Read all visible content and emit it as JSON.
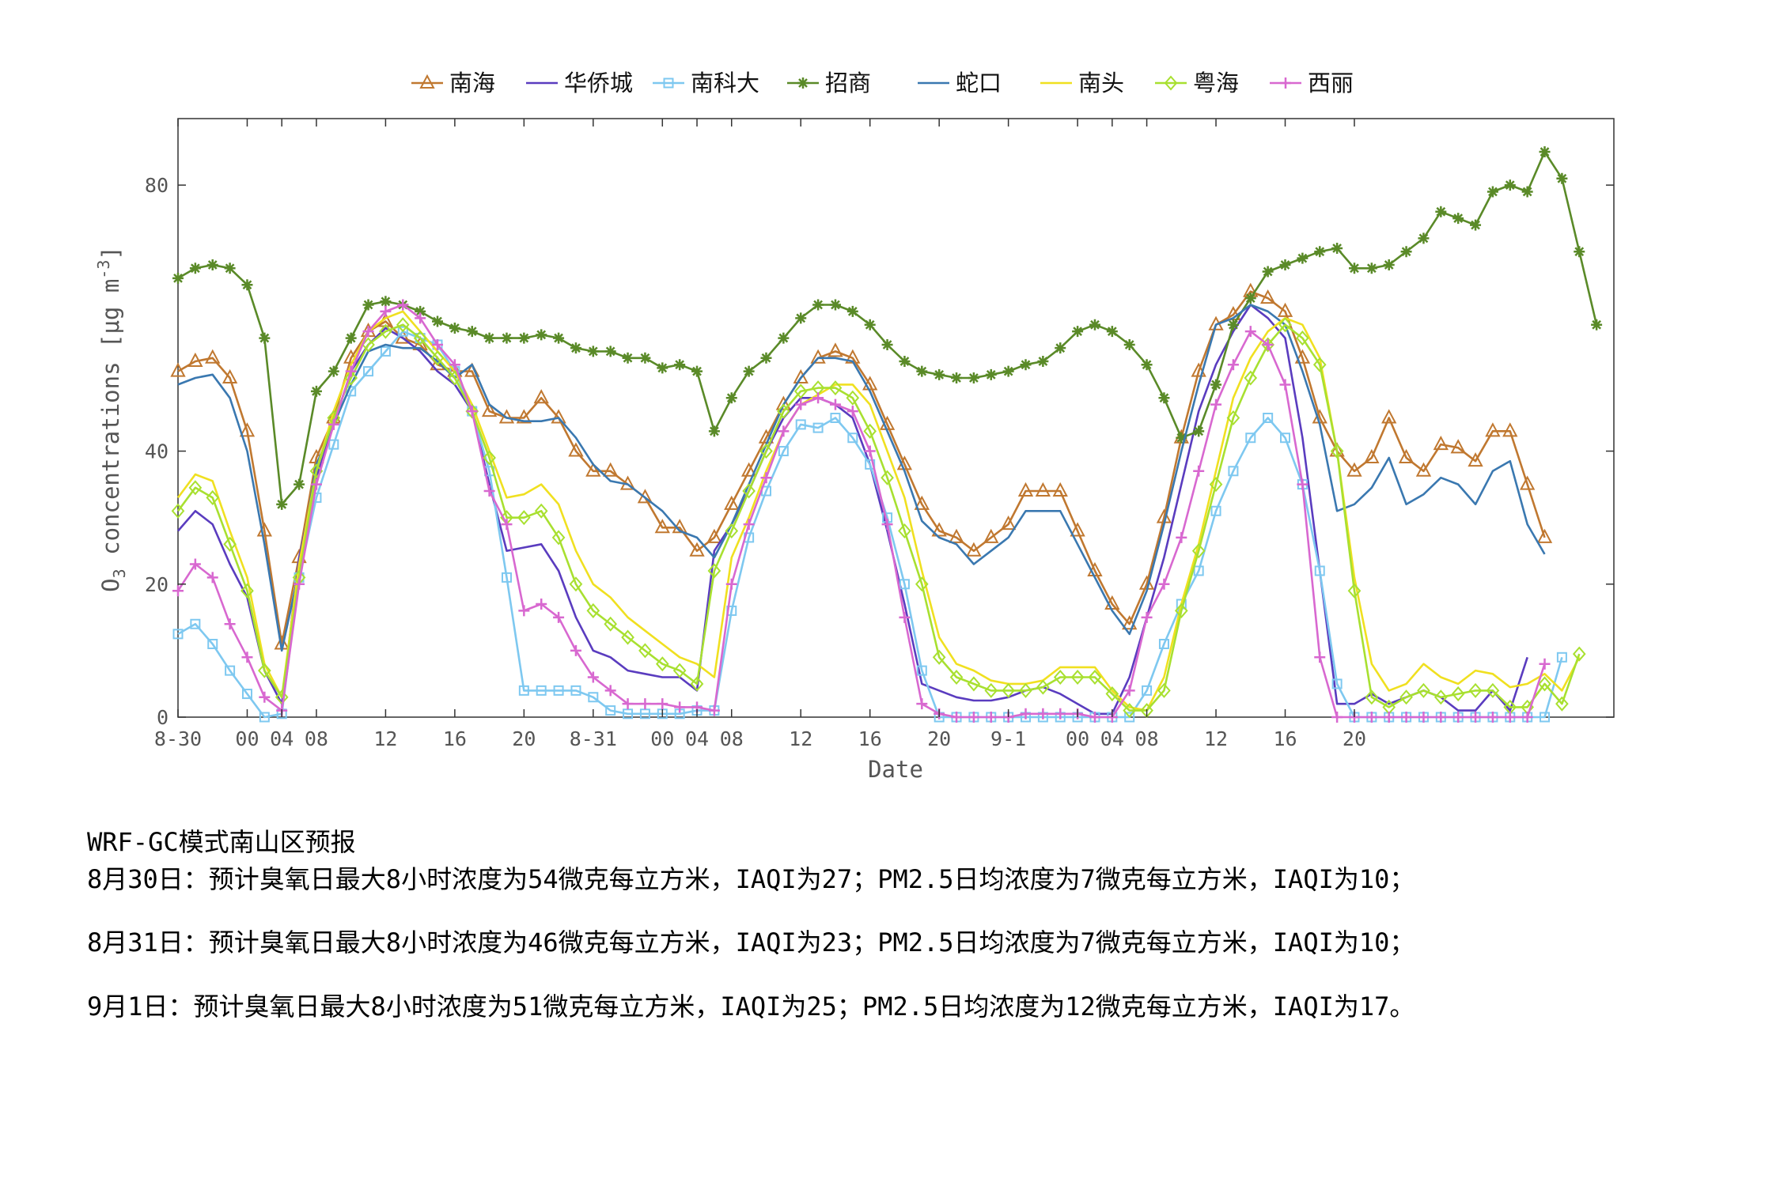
{
  "chart_data": {
    "type": "line",
    "title": "",
    "xlabel": "Date",
    "ylabel_main": "O",
    "ylabel_sub": "3",
    "ylabel_rest": " concentrations [μg m",
    "ylabel_sup": "-3",
    "ylabel_end": "]",
    "ylim": [
      0,
      90
    ],
    "yticks": [
      0,
      20,
      40,
      80
    ],
    "xlim": [
      0,
      83
    ],
    "xticks": [
      {
        "x": 0,
        "label": "8-30"
      },
      {
        "x": 4,
        "label": "00"
      },
      {
        "x": 6,
        "label": "04"
      },
      {
        "x": 8,
        "label": "08"
      },
      {
        "x": 12,
        "label": "12"
      },
      {
        "x": 16,
        "label": "16"
      },
      {
        "x": 20,
        "label": "20"
      },
      {
        "x": 24,
        "label": "8-31"
      },
      {
        "x": 28,
        "label": "00"
      },
      {
        "x": 30,
        "label": "04"
      },
      {
        "x": 32,
        "label": "08"
      },
      {
        "x": 36,
        "label": "12"
      },
      {
        "x": 40,
        "label": "16"
      },
      {
        "x": 44,
        "label": "20"
      },
      {
        "x": 48,
        "label": "9-1"
      },
      {
        "x": 52,
        "label": "00"
      },
      {
        "x": 54,
        "label": "04"
      },
      {
        "x": 56,
        "label": "08"
      },
      {
        "x": 60,
        "label": "12"
      },
      {
        "x": 64,
        "label": "16"
      },
      {
        "x": 68,
        "label": "20"
      }
    ],
    "legend_position": "top",
    "grid": false,
    "series": [
      {
        "name": "南海",
        "color": "#c07830",
        "marker": "triangle",
        "values": [
          52,
          53.5,
          54,
          51,
          43,
          28,
          11,
          24,
          39,
          45,
          54,
          58,
          59.5,
          57,
          56,
          53,
          52,
          52,
          46,
          45,
          45,
          48,
          45,
          40,
          37,
          37,
          35,
          33,
          28.5,
          28.5,
          25,
          27,
          32,
          37,
          42,
          47,
          51,
          54,
          55,
          54,
          50,
          44,
          38,
          32,
          28,
          27,
          25,
          27,
          29,
          34,
          34,
          34,
          28,
          22,
          17,
          14,
          20,
          30,
          42,
          52,
          59,
          60.5,
          64,
          63,
          61,
          54,
          45,
          40,
          37,
          39,
          45,
          39,
          37,
          41,
          40.5,
          38.5,
          43,
          43,
          35,
          27
        ]
      },
      {
        "name": "华侨城",
        "color": "#5a3cbf",
        "marker": "none",
        "values": [
          28,
          31,
          29,
          23,
          18,
          7,
          2,
          24,
          36,
          44,
          52,
          56,
          58.5,
          57,
          55,
          52,
          50,
          46,
          35,
          25,
          25.5,
          26,
          22,
          15,
          10,
          9,
          7,
          6.5,
          6,
          6,
          4,
          25,
          29,
          34,
          40,
          45,
          48,
          48,
          47,
          45,
          38,
          28,
          17,
          5,
          4,
          3,
          2.5,
          2.5,
          3,
          4,
          4.5,
          3.5,
          2,
          0.5,
          0.5,
          6,
          15,
          24,
          35,
          46,
          53,
          58,
          62,
          60,
          57,
          42,
          22,
          2,
          2,
          3.5,
          2,
          3,
          4,
          3,
          1,
          1,
          4,
          1,
          9
        ]
      },
      {
        "name": "南科大",
        "color": "#7ec8f0",
        "marker": "square",
        "values": [
          12.5,
          14,
          11,
          7,
          3.5,
          0,
          0.5,
          21,
          33,
          41,
          49,
          52,
          55,
          58,
          57,
          56,
          52,
          46,
          37,
          21,
          4,
          4,
          4,
          4,
          3,
          1,
          0.5,
          0.5,
          0.5,
          0.5,
          1,
          1,
          16,
          27,
          34,
          40,
          44,
          43.5,
          45,
          42,
          38,
          30,
          20,
          7,
          0,
          0,
          0,
          0,
          0,
          0,
          0,
          0,
          0,
          0,
          0,
          0,
          4,
          11,
          17,
          22,
          31,
          37,
          42,
          45,
          42,
          35,
          22,
          5,
          0,
          0,
          0,
          0,
          0,
          0,
          0,
          0,
          0,
          0,
          0,
          0,
          9
        ]
      },
      {
        "name": "招商",
        "color": "#5a8a28",
        "marker": "star",
        "values": [
          66,
          67.5,
          68,
          67.5,
          65,
          57,
          32,
          35,
          49,
          52,
          57,
          62,
          62.5,
          62,
          61,
          59.5,
          58.5,
          58,
          57,
          57,
          57,
          57.5,
          57,
          55.5,
          55,
          55,
          54,
          54,
          52.5,
          53,
          52,
          43,
          48,
          52,
          54,
          57,
          60,
          62,
          62,
          61,
          59,
          56,
          53.5,
          52,
          51.5,
          51,
          51,
          51.5,
          52,
          53,
          53.5,
          55.5,
          58,
          59,
          58,
          56,
          53,
          48,
          42,
          43,
          50,
          59,
          63,
          67,
          68,
          69,
          70,
          70.5,
          67.5,
          67.5,
          68,
          70,
          72,
          76,
          75,
          74,
          79,
          80,
          79,
          85,
          81,
          70,
          59
        ]
      },
      {
        "name": "蛇口",
        "color": "#3a78b0",
        "marker": "none",
        "values": [
          50,
          51,
          51.5,
          48,
          40,
          26,
          10,
          22,
          38,
          44,
          50,
          55,
          56,
          55.5,
          55.5,
          53.5,
          51,
          53,
          47,
          45,
          44.5,
          44.5,
          45,
          42,
          38,
          35.5,
          35,
          33,
          31,
          28,
          27,
          24,
          29,
          35,
          41,
          47,
          51,
          54,
          54,
          53.5,
          49,
          43,
          37,
          29.5,
          27,
          26,
          23,
          25,
          27,
          31,
          31,
          31,
          26,
          21,
          16,
          12.5,
          19,
          29,
          40,
          50,
          59,
          60,
          62,
          61,
          59,
          52,
          44,
          31,
          32,
          34.5,
          39,
          32,
          33.5,
          36,
          35,
          32,
          37,
          38.5,
          29,
          24.5
        ]
      },
      {
        "name": "南头",
        "color": "#f0e020",
        "marker": "none",
        "values": [
          33,
          36.5,
          35.5,
          28,
          21,
          8,
          3,
          23,
          37,
          46,
          53,
          58,
          60,
          61,
          58,
          55,
          52,
          47,
          40,
          33,
          33.5,
          35,
          32,
          25,
          20,
          18,
          15,
          13,
          11,
          9,
          8,
          6,
          24,
          30,
          37,
          43,
          47,
          48.5,
          50,
          50,
          47,
          40,
          33,
          22,
          12,
          8,
          7,
          5.5,
          5,
          5,
          5.5,
          7.5,
          7.5,
          7.5,
          4,
          1.5,
          1,
          6,
          17,
          26,
          37,
          48,
          54,
          58,
          60,
          59,
          54,
          40,
          21,
          8,
          4,
          5,
          8,
          6,
          5,
          7,
          6.5,
          4.5,
          5,
          6.5,
          4,
          9
        ]
      },
      {
        "name": "粤海",
        "color": "#a8e030",
        "marker": "diamond",
        "values": [
          31,
          34.5,
          33,
          26,
          19,
          7,
          3,
          21,
          37,
          45,
          51,
          56,
          58,
          59,
          57,
          54,
          51,
          46,
          39,
          30,
          30,
          31,
          27,
          20,
          16,
          14,
          12,
          10,
          8,
          7,
          5,
          22,
          28,
          34,
          40,
          46,
          49,
          49.5,
          49.5,
          48,
          43,
          36,
          28,
          20,
          9,
          6,
          5,
          4,
          4,
          4,
          4.5,
          6,
          6,
          6,
          3.5,
          1,
          1,
          4,
          16,
          25,
          35,
          45,
          51,
          56,
          59,
          57,
          53,
          40,
          19,
          3,
          1.5,
          3,
          4,
          3,
          3.5,
          4,
          4,
          1.5,
          1.5,
          5,
          2,
          9.5
        ]
      },
      {
        "name": "西丽",
        "color": "#d868d0",
        "marker": "plus",
        "values": [
          19,
          23,
          21,
          14,
          9,
          3,
          1,
          20,
          35,
          44,
          52,
          58,
          61,
          62,
          60,
          56,
          53,
          46,
          34,
          29,
          16,
          17,
          15,
          10,
          6,
          4,
          2,
          2,
          2,
          1.5,
          1.5,
          1,
          20,
          29,
          36,
          43,
          47,
          48,
          47,
          46,
          40,
          29,
          15,
          2,
          0.5,
          0,
          0,
          0,
          0,
          0.5,
          0.5,
          0.5,
          0.5,
          0,
          0,
          4,
          15,
          20,
          27,
          37,
          47,
          53,
          58,
          56,
          50,
          35,
          9,
          0,
          0,
          0,
          0,
          0,
          0,
          0,
          0,
          0,
          0,
          0,
          0,
          8
        ]
      }
    ]
  },
  "summary": {
    "title": "WRF-GC模式南山区预报",
    "lines": [
      "8月30日：预计臭氧日最大8小时浓度为54微克每立方米，IAQI为27；PM2.5日均浓度为7微克每立方米，IAQI为10；",
      "8月31日：预计臭氧日最大8小时浓度为46微克每立方米，IAQI为23；PM2.5日均浓度为7微克每立方米，IAQI为10；",
      "9月1日：预计臭氧日最大8小时浓度为51微克每立方米，IAQI为25；PM2.5日均浓度为12微克每立方米，IAQI为17。"
    ]
  }
}
